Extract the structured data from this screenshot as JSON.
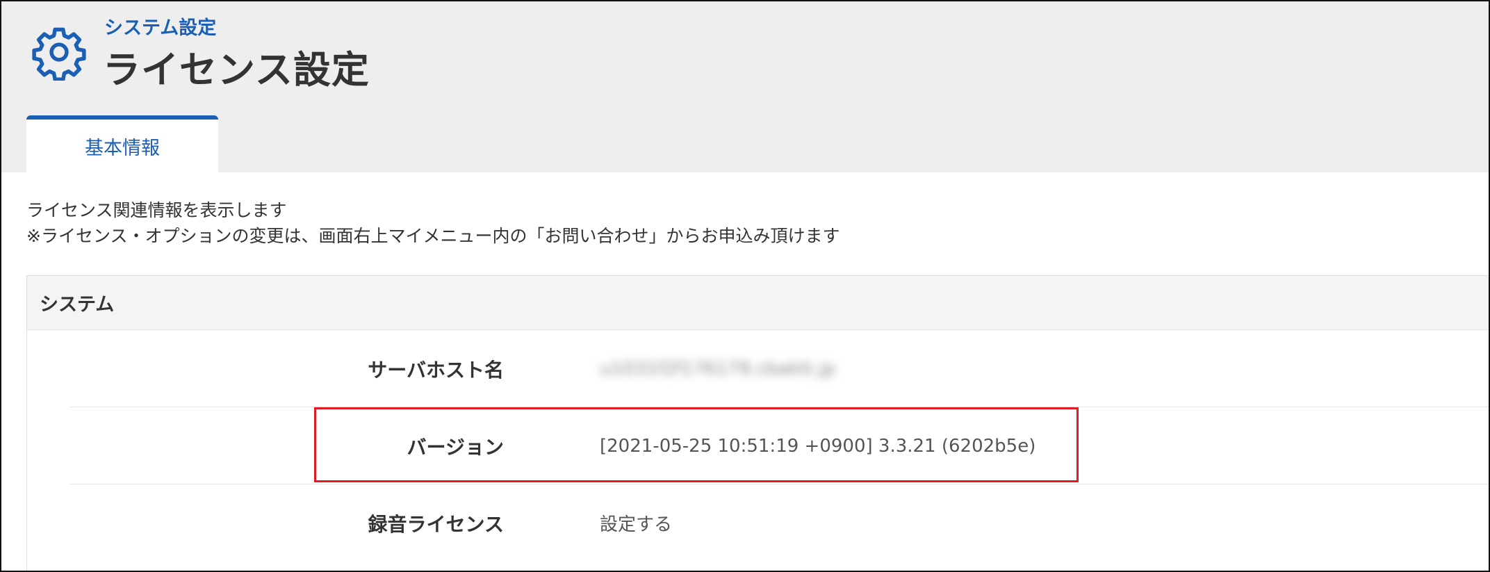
{
  "header": {
    "breadcrumb": "システム設定",
    "title": "ライセンス設定",
    "icon": "gear-icon"
  },
  "tabs": [
    {
      "label": "基本情報",
      "active": true
    }
  ],
  "description": {
    "line1": "ライセンス関連情報を表示します",
    "line2": "※ライセンス・オプションの変更は、画面右上マイメニュー内の「お問い合わせ」からお申込み頂けます"
  },
  "panel": {
    "title": "システム",
    "rows": [
      {
        "label": "サーバホスト名",
        "value": "u1031f2f176179.cbaktt.jp",
        "blurred": true
      },
      {
        "label": "バージョン",
        "value": "[2021-05-25 10:51:19 +0900] 3.3.21 (6202b5e)",
        "highlighted": true
      },
      {
        "label": "録音ライセンス",
        "value": "設定する"
      }
    ]
  },
  "colors": {
    "accent": "#1a5fb4",
    "highlight": "#e01b24",
    "header_bg": "#eeeeee",
    "panel_header_bg": "#f4f4f4"
  }
}
